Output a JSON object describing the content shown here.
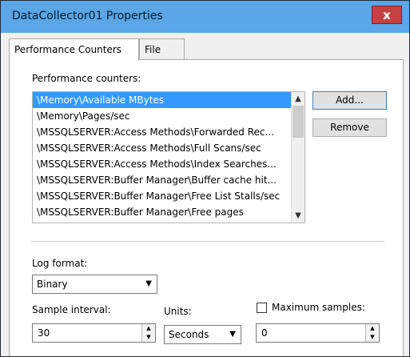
{
  "window": {
    "title": "DataCollector01 Properties",
    "close_label": "x"
  },
  "tabs": [
    {
      "label": "Performance Counters",
      "active": true
    },
    {
      "label": "File",
      "active": false
    }
  ],
  "counters": {
    "label": "Performance counters:",
    "items": [
      "\\Memory\\Available MBytes",
      "\\Memory\\Pages/sec",
      "\\MSSQLSERVER:Access Methods\\Forwarded Rec...",
      "\\MSSQLSERVER:Access Methods\\Full Scans/sec",
      "\\MSSQLSERVER:Access Methods\\Index Searches...",
      "\\MSSQLSERVER:Buffer Manager\\Buffer cache hit...",
      "\\MSSQLSERVER:Buffer Manager\\Free List Stalls/sec",
      "\\MSSQLSERVER:Buffer Manager\\Free pages"
    ],
    "selected_index": 0,
    "add_label": "Add...",
    "remove_label": "Remove"
  },
  "log_format": {
    "label": "Log format:",
    "value": "Binary"
  },
  "sample_interval": {
    "label": "Sample interval:",
    "value": "30"
  },
  "units": {
    "label": "Units:",
    "value": "Seconds"
  },
  "max_samples": {
    "label": "Maximum samples:",
    "value": "0",
    "checked": false
  },
  "icons": {
    "scroll_up": "▲",
    "scroll_down": "▼",
    "dropdown": "▼",
    "spin_up": "▲",
    "spin_down": "▼"
  }
}
